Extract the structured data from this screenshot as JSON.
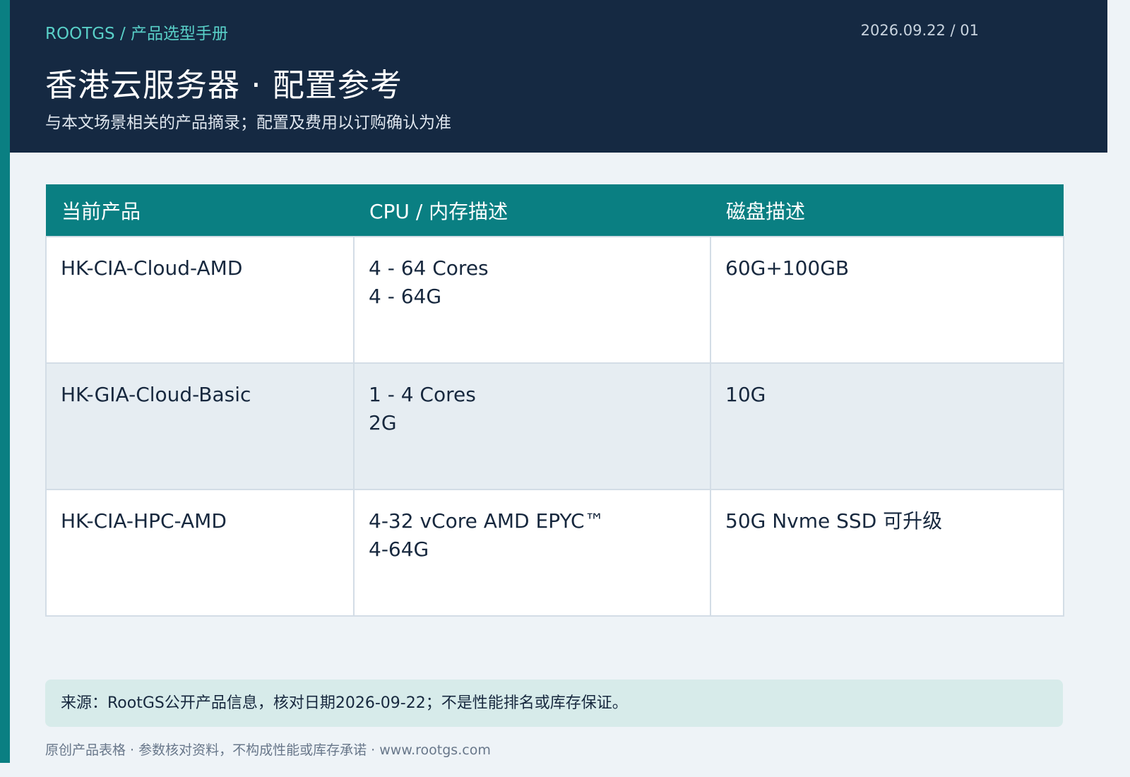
{
  "header": {
    "breadcrumb": "ROOTGS / 产品选型手册",
    "date_code": "2026.09.22 / 01",
    "title": "香港云服务器 · 配置参考",
    "subtitle": "与本文场景相关的产品摘录；配置及费用以订购确认为准"
  },
  "table": {
    "headers": [
      "当前产品",
      "CPU / 内存描述",
      "磁盘描述"
    ],
    "rows": [
      {
        "product": "HK-CIA-Cloud-AMD",
        "cpu": "4 - 64 Cores",
        "memory": "4 - 64G",
        "disk": "60G+100GB"
      },
      {
        "product": "HK-GIA-Cloud-Basic",
        "cpu": "1 - 4 Cores",
        "memory": "2G",
        "disk": "10G"
      },
      {
        "product": "HK-CIA-HPC-AMD",
        "cpu": "4-32 vCore AMD EPYC™",
        "memory": "4-64G",
        "disk": "50G Nvme SSD 可升级"
      }
    ]
  },
  "note": "来源：RootGS公开产品信息，核对日期2026-09-22；不是性能排名或库存保证。",
  "footer": "原创产品表格 · 参数核对资料，不构成性能或库存承诺 · www.rootgs.com",
  "colors": {
    "header_bg": "#152942",
    "accent": "#0a7f82",
    "breadcrumb": "#59d0c8",
    "note_bg": "#d7ebea"
  }
}
